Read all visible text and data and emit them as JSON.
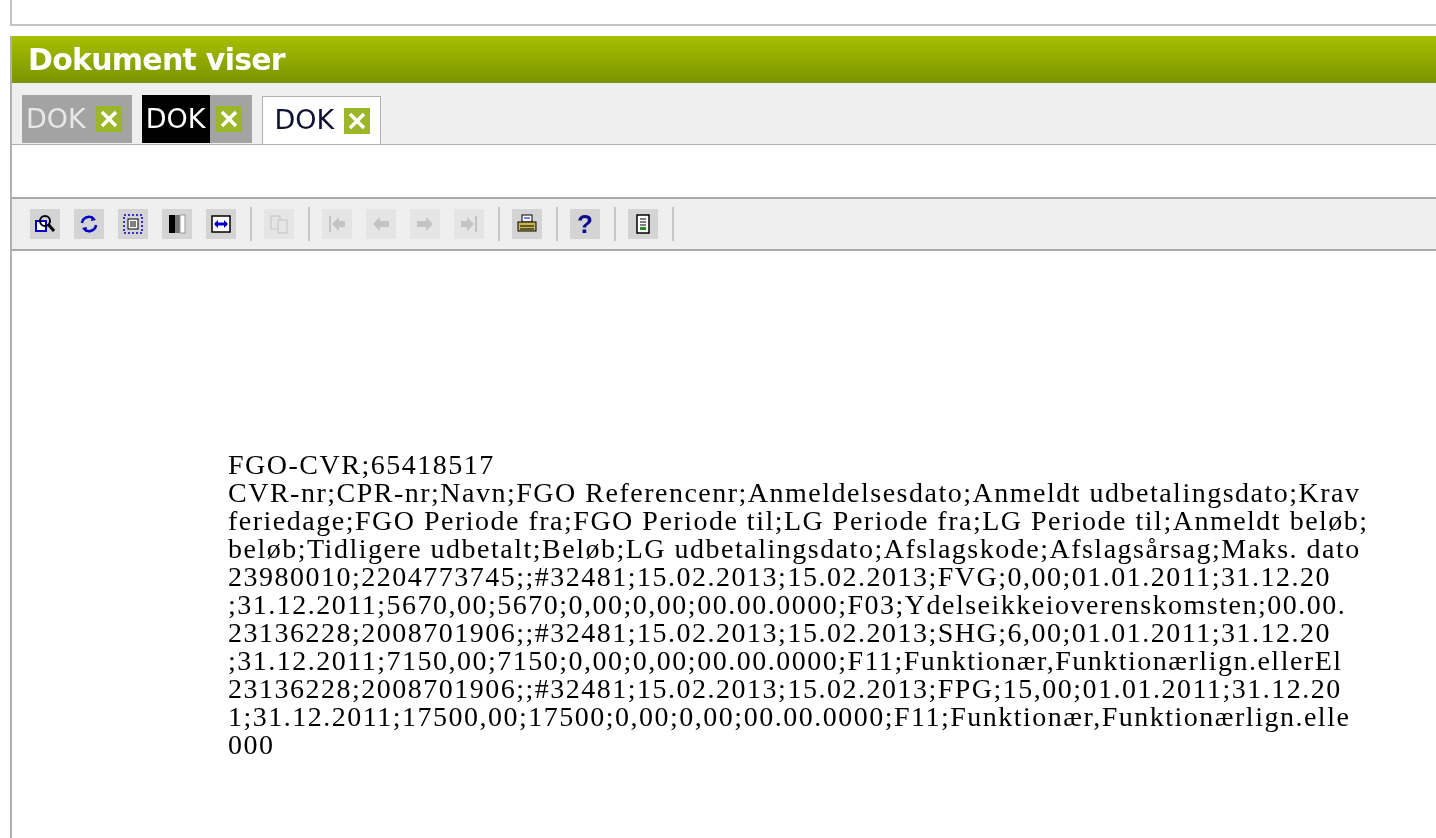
{
  "panel": {
    "title": "Dokument viser"
  },
  "tabs": [
    {
      "label": "DOK",
      "selected": false,
      "highlighted": false
    },
    {
      "label": "DOK",
      "selected": false,
      "highlighted": true
    },
    {
      "label": "DOK",
      "selected": true,
      "highlighted": false
    }
  ],
  "toolbar": {
    "groups": [
      [
        {
          "kind": "zoom",
          "disabled": false
        },
        {
          "kind": "refresh",
          "disabled": false
        },
        {
          "kind": "fit",
          "disabled": false
        },
        {
          "kind": "contrast",
          "disabled": false
        },
        {
          "kind": "swap",
          "disabled": false
        }
      ],
      [
        {
          "kind": "copy",
          "disabled": true
        }
      ],
      [
        {
          "kind": "first",
          "disabled": true
        },
        {
          "kind": "prev",
          "disabled": true
        },
        {
          "kind": "next",
          "disabled": true
        },
        {
          "kind": "last",
          "disabled": true
        }
      ],
      [
        {
          "kind": "print",
          "disabled": false
        }
      ],
      [
        {
          "kind": "help",
          "disabled": false,
          "label": "?"
        }
      ],
      [
        {
          "kind": "page",
          "disabled": false
        }
      ]
    ]
  },
  "document": {
    "lines": [
      "FGO-CVR;65418517",
      "CVR-nr;CPR-nr;Navn;FGO Referencenr;Anmeldelsesdato;Anmeldt udbetalingsdato;Krav",
      "feriedage;FGO Periode fra;FGO Periode til;LG Periode fra;LG Periode til;Anmeldt beløb;",
      "beløb;Tidligere udbetalt;Beløb;LG udbetalingsdato;Afslagskode;Afslagsårsag;Maks. dato",
      "23980010;2204773745;;#32481;15.02.2013;15.02.2013;FVG;0,00;01.01.2011;31.12.20",
      ";31.12.2011;5670,00;5670;0,00;0,00;00.00.0000;F03;Ydelseikkeioverenskomsten;00.00.",
      "23136228;2008701906;;#32481;15.02.2013;15.02.2013;SHG;6,00;01.01.2011;31.12.20",
      ";31.12.2011;7150,00;7150;0,00;0,00;00.00.0000;F11;Funktionær,Funktionærlign.ellerEl",
      "23136228;2008701906;;#32481;15.02.2013;15.02.2013;FPG;15,00;01.01.2011;31.12.20",
      "1;31.12.2011;17500,00;17500;0,00;0,00;00.00.0000;F11;Funktionær,Funktionærlign.elle",
      "000"
    ]
  }
}
